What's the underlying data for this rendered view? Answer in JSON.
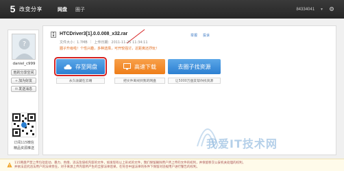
{
  "header": {
    "logo_mark": "5",
    "logo_text": "改变分享",
    "nav": [
      "网盘",
      "圈子"
    ],
    "user_id": "84334041",
    "caret": "▼",
    "menu_icon": "gear-icon"
  },
  "sidebar": {
    "username": "daniel_c999",
    "buttons": [
      {
        "label": "他的分享空间",
        "icon": ""
      },
      {
        "label": "加为好友",
        "icon": "+"
      },
      {
        "label": "发送消息",
        "icon": "✉"
      }
    ],
    "qr_caption_1": "订阅115微信",
    "qr_caption_2": "精品资源推送"
  },
  "file": {
    "name": "HTCDriver3[1].0.0.008_x32.rar",
    "size": "文件大小：1.7MB",
    "upload_label": "上传日期：2011-11-25 11:34:11",
    "links": [
      "举报",
      "投诉"
    ],
    "notice": "圈子升级啦！个性兴趣，多种选择，可开较强讨，近距离还抒玩！"
  },
  "actions": [
    {
      "label": "存至网盘",
      "sub": "永久收藏在云端",
      "icon": "cloud-icon"
    },
    {
      "label": "高速下载",
      "sub": "把文件离线到我的网盘",
      "icon": "monitor-icon"
    },
    {
      "label": "去圈子找资源",
      "sub": "让5000万盘友帮你找资源",
      "icon": ""
    }
  ],
  "watermark": "我爱IT技术网",
  "footer": {
    "text": "115网盘严禁上传包括反动、暴力、色情、违法及侵权内容的文件，如发现有以上形式的文件，我们保留删除用户所上传的文件的权利，并保留移交公安机关处理的权利，并依法追究违法用户的法律责任，对于来源上传内容所产生的全部法律后果，在符合中国法律的条件下保留对违规用户进行警告的权利。",
    "icon": "warning-icon"
  },
  "colors": {
    "topbar": "#2e2e2e",
    "blue_button": "#3a8ada",
    "orange_button": "#f08a26",
    "highlight": "#d62020",
    "notice": "#e0691b"
  }
}
